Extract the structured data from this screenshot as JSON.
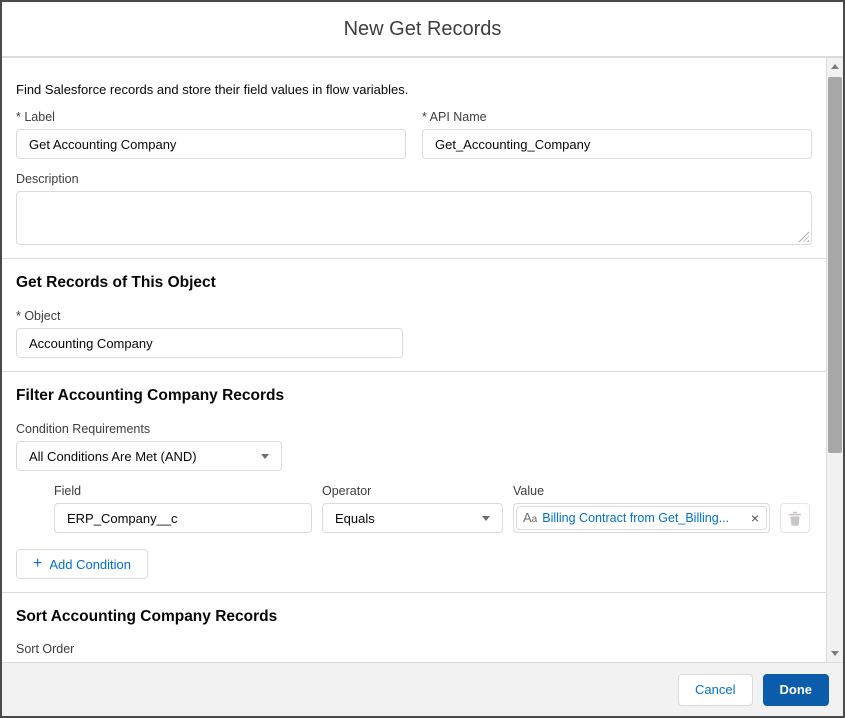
{
  "modal": {
    "title": "New Get Records",
    "intro": "Find Salesforce records and store their field values in flow variables."
  },
  "form": {
    "label_field": {
      "label": "* Label",
      "value": "Get Accounting Company"
    },
    "api_name_field": {
      "label": "* API Name",
      "value": "Get_Accounting_Company"
    },
    "description_field": {
      "label": "Description",
      "value": ""
    },
    "object_section": {
      "heading": "Get Records of This Object",
      "object_field": {
        "label": "* Object",
        "value": "Accounting Company"
      }
    },
    "filter_section": {
      "heading": "Filter Accounting Company Records",
      "condition_requirements": {
        "label": "Condition Requirements",
        "value": "All Conditions Are Met (AND)"
      },
      "condition_row": {
        "field": {
          "label": "Field",
          "value": "ERP_Company__c"
        },
        "operator": {
          "label": "Operator",
          "value": "Equals"
        },
        "value": {
          "label": "Value",
          "pill_text": "Billing Contract from Get_Billing..."
        }
      },
      "add_condition_label": "Add Condition"
    },
    "sort_section": {
      "heading": "Sort Accounting Company Records",
      "sort_order_label": "Sort Order"
    }
  },
  "footer": {
    "cancel_label": "Cancel",
    "done_label": "Done"
  },
  "icons": {
    "plus": "+",
    "remove": "×",
    "text_type_large": "A",
    "text_type_small": "a"
  },
  "colors": {
    "accent_blue": "#0070d2",
    "done_button_bg": "#0b5cab"
  }
}
